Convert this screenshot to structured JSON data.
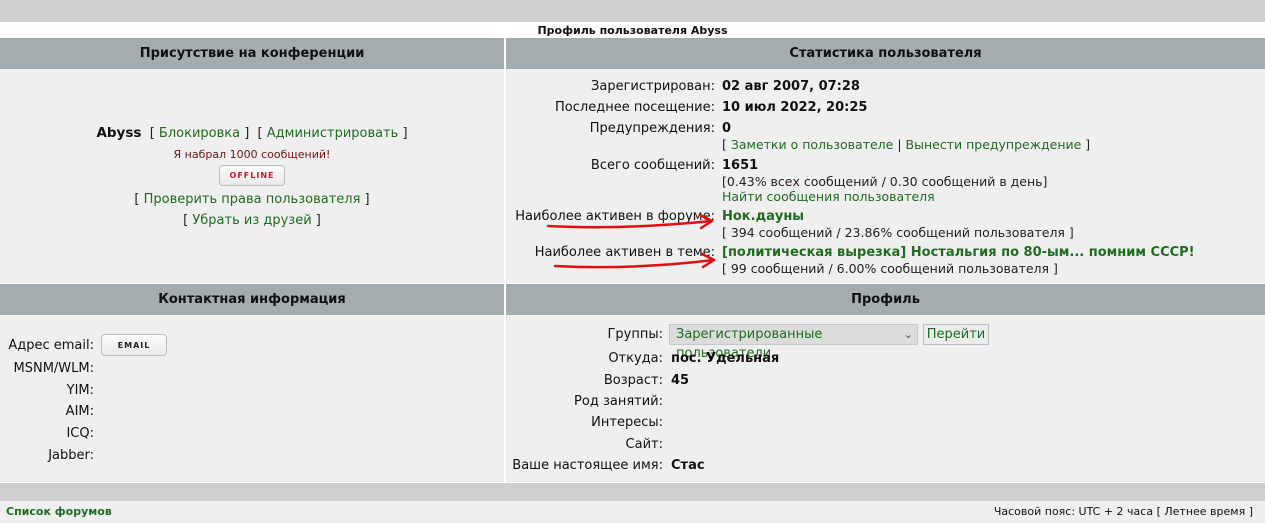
{
  "page_title": "Профиль пользователя Abyss",
  "presence": {
    "header": "Присутствие на конференции",
    "username": "Abyss",
    "block_label": "Блокировка",
    "admin_label": "Администрировать",
    "rank": "Я набрал 1000 сообщений!",
    "status_badge": "OFFLINE",
    "check_rights_label": "Проверить права пользователя",
    "remove_friend_label": "Убрать из друзей"
  },
  "stats": {
    "header": "Статистика пользователя",
    "registered_label": "Зарегистрирован:",
    "registered_value": "02 авг 2007, 07:28",
    "last_visit_label": "Последнее посещение:",
    "last_visit_value": "10 июл 2022, 20:25",
    "warnings_label": "Предупреждения:",
    "warnings_value": "0",
    "notes_link": "Заметки о пользователе",
    "warn_link": "Вынести предупреждение",
    "posts_label": "Всего сообщений:",
    "posts_value": "1651",
    "posts_detail": "[0.43% всех сообщений / 0.30 сообщений в день]",
    "find_posts_link": "Найти сообщения пользователя",
    "active_forum_label": "Наиболее активен в форуме:",
    "active_forum_value": "Нок.дауны",
    "active_forum_detail": "[ 394 сообщений / 23.86% сообщений пользователя ]",
    "active_topic_label": "Наиболее активен в теме:",
    "active_topic_value": "[политическая вырезка] Ностальгия по 80-ым... помним СССР!",
    "active_topic_detail": "[ 99 сообщений / 6.00% сообщений пользователя ]"
  },
  "contact": {
    "header": "Контактная информация",
    "email_label": "Адрес email:",
    "email_button": "EMAIL",
    "msn_label": "MSNM/WLM:",
    "yim_label": "YIM:",
    "aim_label": "AIM:",
    "icq_label": "ICQ:",
    "jabber_label": "Jabber:"
  },
  "profile": {
    "header": "Профиль",
    "groups_label": "Группы:",
    "groups_selected": "Зарегистрированные пользователи",
    "go_button": "Перейти",
    "from_label": "Откуда:",
    "from_value": "пос. Удельная",
    "age_label": "Возраст:",
    "age_value": "45",
    "occupation_label": "Род занятий:",
    "interests_label": "Интересы:",
    "site_label": "Сайт:",
    "realname_label": "Ваше настоящее имя:",
    "realname_value": "Стас"
  },
  "footer": {
    "forum_list": "Список форумов",
    "timezone": "Часовой пояс: UTC + 2 часа",
    "dst": "Летнее время"
  },
  "colors": {
    "header_bg": "#a5acb0",
    "cell_bg": "#efefef",
    "link": "#1f6b1f",
    "arrow": "#e01010"
  }
}
